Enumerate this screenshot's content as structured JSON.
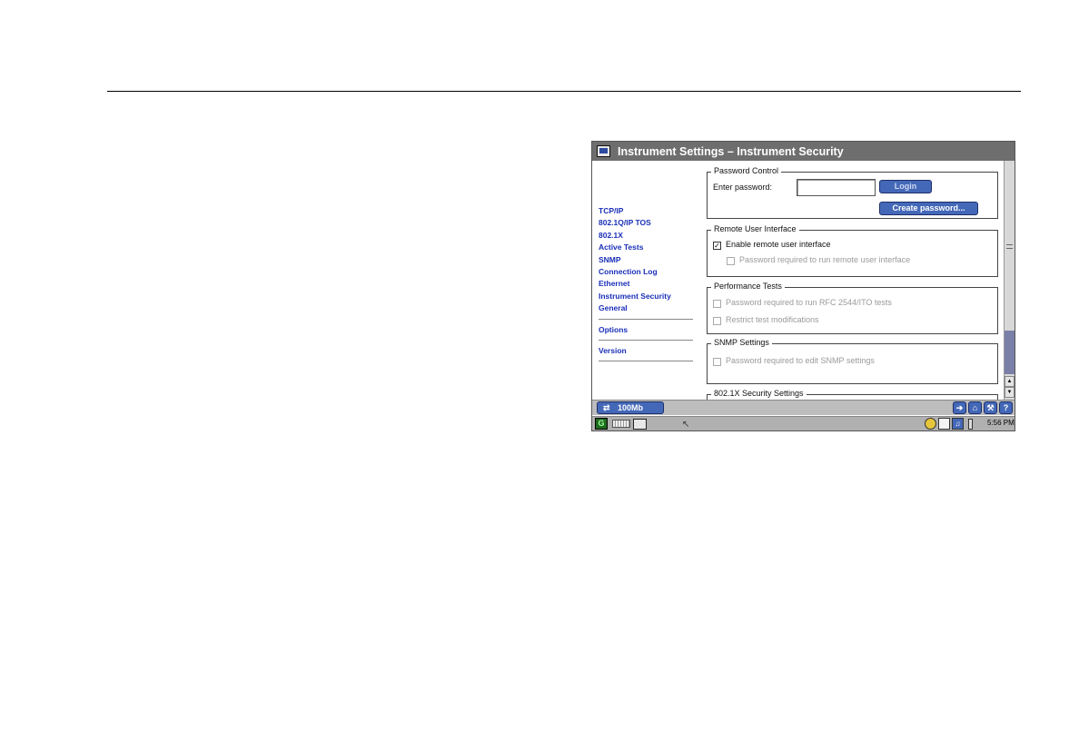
{
  "window": {
    "title": "Instrument Settings – Instrument Security",
    "app_icon": "window-icon"
  },
  "sidebar": {
    "items": [
      {
        "label": "TCP/IP"
      },
      {
        "label": "802.1Q/IP TOS"
      },
      {
        "label": "802.1X"
      },
      {
        "label": "Active Tests"
      },
      {
        "label": "SNMP"
      },
      {
        "label": "Connection Log"
      },
      {
        "label": "Ethernet"
      },
      {
        "label": "Instrument Security"
      },
      {
        "label": "General"
      }
    ],
    "options_label": "Options",
    "version_label": "Version"
  },
  "password_control": {
    "legend": "Password Control",
    "enter_label": "Enter password:",
    "password_value": "",
    "login_button": "Login",
    "create_button": "Create password..."
  },
  "remote_ui": {
    "legend": "Remote User Interface",
    "enable_label": "Enable remote user interface",
    "enable_checked": true,
    "password_label": "Password required to run remote user interface",
    "password_checked": false
  },
  "performance": {
    "legend": "Performance Tests",
    "rfc_label": "Password required to run RFC 2544/ITO tests",
    "restrict_label": "Restrict test modifications"
  },
  "snmp": {
    "legend": "SNMP Settings",
    "password_label": "Password required to edit SNMP settings"
  },
  "security_8021x": {
    "legend": "802.1X Security Settings"
  },
  "statusbar": {
    "link_speed": "100Mb",
    "link_icon": "link-arrows-icon",
    "tools": [
      {
        "icon": "back-arrow-icon",
        "glyph": "➔"
      },
      {
        "icon": "home-icon",
        "glyph": "⌂"
      },
      {
        "icon": "wrench-icon",
        "glyph": "⚒"
      },
      {
        "icon": "help-icon",
        "glyph": "?"
      }
    ]
  },
  "taskbar": {
    "time": "5:56 PM"
  },
  "colors": {
    "titlebar": "#6e6e6e",
    "accent_button": "#4468b8",
    "nav_link": "#1a2fb8",
    "scroll_thumb": "#7a7fa8"
  }
}
